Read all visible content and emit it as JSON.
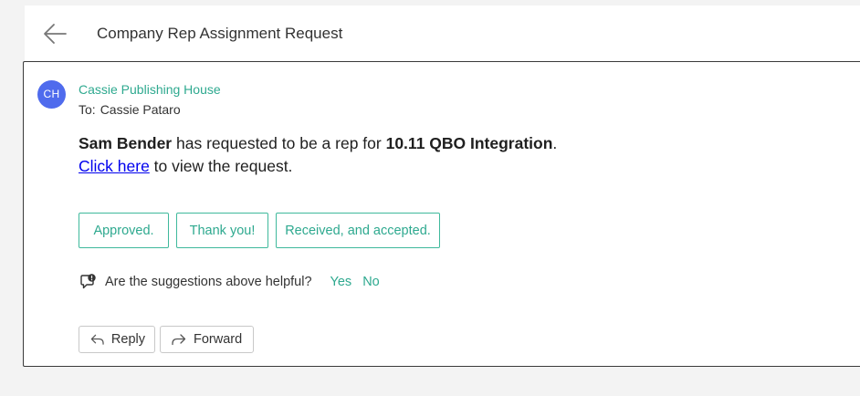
{
  "header": {
    "title": "Company Rep Assignment Request",
    "back_icon": "back-arrow-icon"
  },
  "message": {
    "avatar_initials": "CH",
    "avatar_color": "#4f6bed",
    "sender": "Cassie Publishing House",
    "to_label": "To:",
    "recipient": "Cassie Pataro",
    "body": {
      "requester": "Sam Bender",
      "middle_text": " has requested to be a rep for ",
      "project": "10.11 QBO Integration",
      "end_punct": ".",
      "link_text": "Click here",
      "after_link": " to view the request."
    }
  },
  "suggestions": [
    "Approved.",
    "Thank you!",
    "Received, and accepted."
  ],
  "feedback": {
    "icon": "feedback-icon",
    "question": "Are the suggestions above helpful?",
    "yes": "Yes",
    "no": "No"
  },
  "actions": {
    "reply": "Reply",
    "forward": "Forward"
  },
  "colors": {
    "accent": "#2ea98f",
    "link": "#0000ee",
    "background": "#f3f3f3"
  }
}
